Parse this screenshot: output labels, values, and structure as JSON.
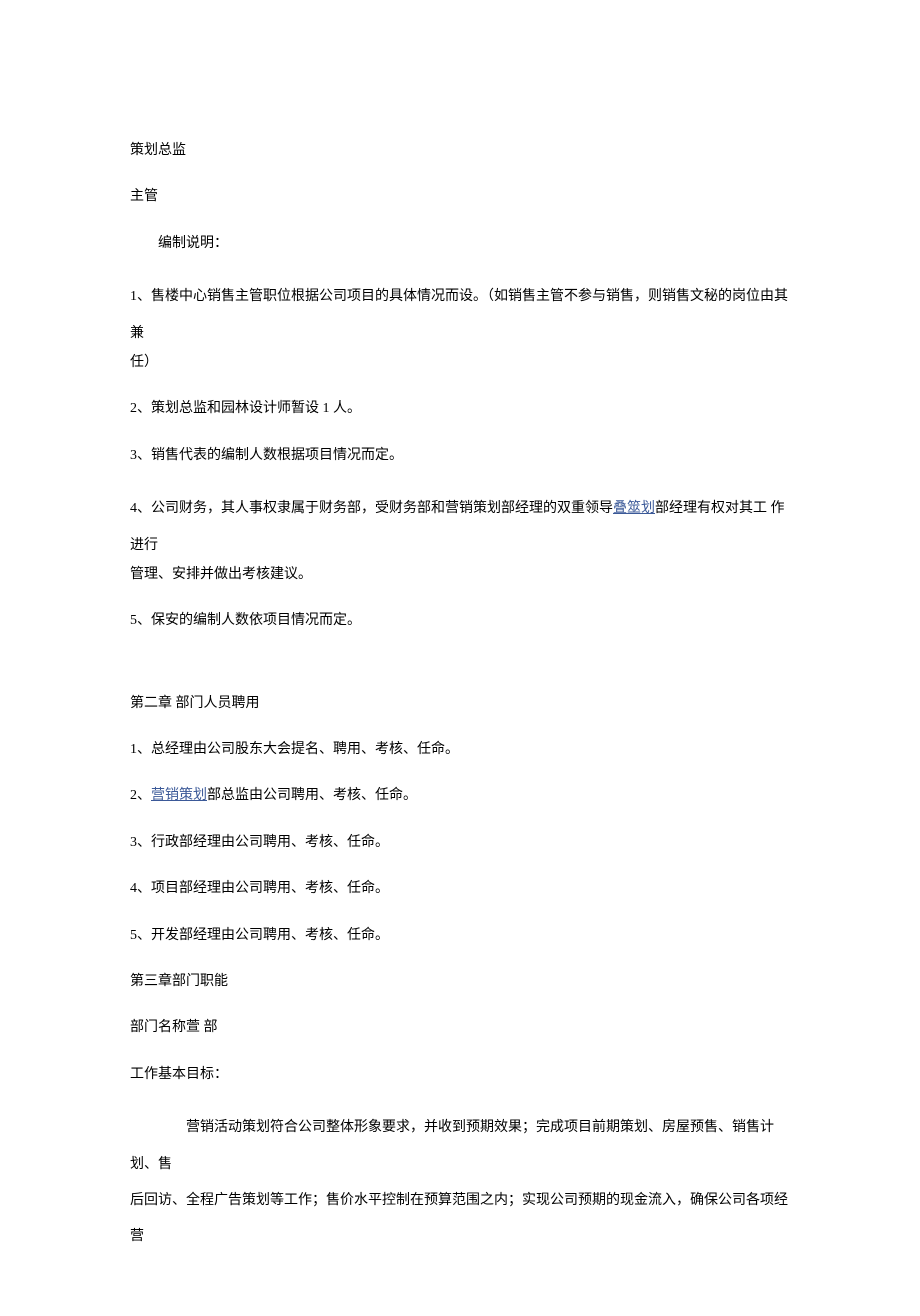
{
  "lines": {
    "l1": "策划总监",
    "l2": "主管",
    "l3": "编制说明：",
    "l4_a": "1、售楼中心销售主管职位根据公司项目的具体情况而设。（如销售主管不参与销售，则销售文秘的岗位由其 兼",
    "l4_b": "任）",
    "l5": "2、策划总监和园林设计师暂设 1 人。",
    "l6": "3、销售代表的编制人数根据项目情况而定。",
    "l7_a": "4、公司财务，其人事权隶属于财务部，受财务部和营销策划部经理的双重领导",
    "l7_link": "叠筮划",
    "l7_b": "部经理有权对其工 作进行",
    "l7_c": "管理、安排并做出考核建议。",
    "l8": "5、保安的编制人数依项目情况而定。",
    "ch2_title": "第二章 部门人员聘用",
    "ch2_1": "1、总经理由公司股东大会提名、聘用、考核、任命。",
    "ch2_2a": "2、",
    "ch2_2link": "营销策划",
    "ch2_2b": "部总监由公司聘用、考核、任命。",
    "ch2_3": "3、行政部经理由公司聘用、考核、任命。",
    "ch2_4": "4、项目部经理由公司聘用、考核、任命。",
    "ch2_5": "5、开发部经理由公司聘用、考核、任命。",
    "ch3_title": "第三章部门职能",
    "dept_name": "部门名称萱 部",
    "goal_title": "工作基本目标：",
    "goal_p1": "营销活动策划符合公司整体形象要求，并收到预期效果；完成项目前期策划、房屋预售、销售计划、售",
    "goal_p2": "后回访、全程广告策划等工作；售价水平控制在预算范围之内；实现公司预期的现金流入，确保公司各项经营"
  }
}
